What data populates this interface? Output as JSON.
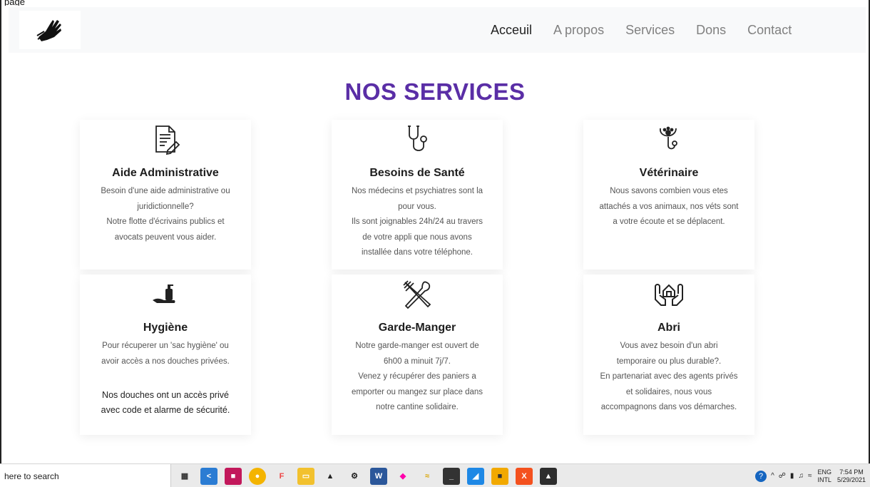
{
  "window": {
    "top_snip_text": "page"
  },
  "nav": {
    "items": [
      {
        "label": "Acceuil",
        "active": true
      },
      {
        "label": "A propos",
        "active": false
      },
      {
        "label": "Services",
        "active": false
      },
      {
        "label": "Dons",
        "active": false
      },
      {
        "label": "Contact",
        "active": false
      }
    ]
  },
  "section": {
    "title": "NOS SERVICES"
  },
  "services": [
    {
      "title": "Aide Administrative",
      "icon": "document-pen-icon",
      "text": [
        "Besoin d'une aide administrative ou",
        "juridictionnelle?",
        "Notre flotte d'écrivains publics et",
        "avocats peuvent vous aider."
      ]
    },
    {
      "title": "Besoins de Santé",
      "icon": "stethoscope-icon",
      "text": [
        "Nos médecins et psychiatres sont la",
        "pour vous.",
        "Ils sont joignables 24h/24 au travers",
        "de votre appli que nous avons",
        "installée dans votre téléphone."
      ]
    },
    {
      "title": "Vétérinaire",
      "icon": "paw-stethoscope-icon",
      "text": [
        "Nous savons combien vous etes",
        "attachés a vos animaux, nos véts sont",
        "a votre écoute et se déplacent."
      ]
    },
    {
      "title": "Hygiène",
      "icon": "soap-hand-icon",
      "text": [
        "Pour récuperer un 'sac hygiène' ou",
        "avoir accès a nos douches privées."
      ],
      "extra": [
        "Nos douches ont un accès privé",
        "avec code et alarme de sécurité."
      ]
    },
    {
      "title": "Garde-Manger",
      "icon": "fork-spoon-icon",
      "text": [
        "Notre garde-manger est ouvert de",
        "6h00 a minuit 7j/7.",
        "Venez y récupérer des paniers a",
        "emporter ou mangez sur place dans",
        "notre cantine solidaire."
      ]
    },
    {
      "title": "Abri",
      "icon": "hands-house-icon",
      "text": [
        "Vous avez besoin d'un abri",
        "temporaire ou plus durable?.",
        "En partenariat avec des agents privés",
        "et solidaires, nous vous",
        "accompagnons dans vos démarches."
      ]
    }
  ],
  "taskbar": {
    "search_placeholder": "here to search",
    "lang_top": "ENG",
    "lang_bottom": "INTL",
    "time": "7:54 PM",
    "date": "5/29/2021"
  }
}
